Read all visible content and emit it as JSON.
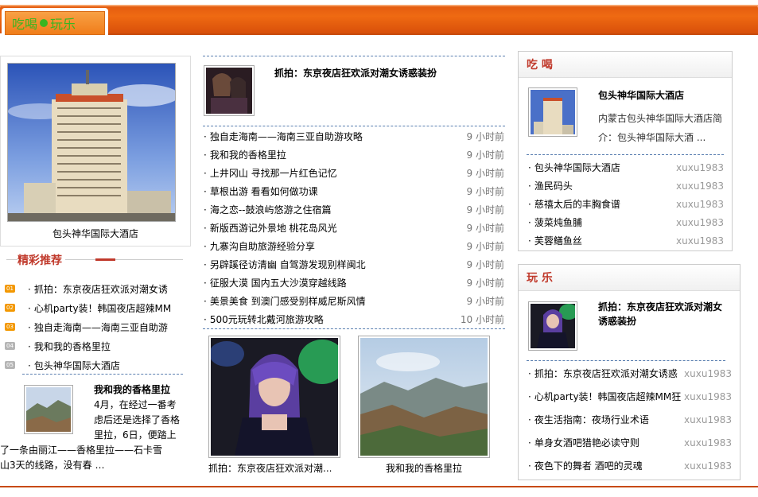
{
  "header": {
    "tab_part1": "吃喝",
    "tab_part2": "玩乐"
  },
  "left": {
    "feature_caption": "包头神华国际大酒店",
    "recommend_title": "精彩推荐",
    "recommend_items": [
      {
        "num": "01",
        "num_color": "#f39800",
        "label": "抓拍：东京夜店狂欢派对潮女诱"
      },
      {
        "num": "02",
        "num_color": "#f39800",
        "label": "心机party装！韩国夜店超辣MM"
      },
      {
        "num": "03",
        "num_color": "#f39800",
        "label": "独自走海南——海南三亚自助游"
      },
      {
        "num": "04",
        "num_color": "#b5b5b5",
        "label": "我和我的香格里拉"
      },
      {
        "num": "05",
        "num_color": "#b5b5b5",
        "label": "包头神华国际大酒店"
      }
    ],
    "article_title": "我和我的香格里拉",
    "article_line1": "4月，在经过一番考",
    "article_line2": "虑后还是选择了香格",
    "article_line3": "里拉，6日，便踏上",
    "article_line4": "了一条由丽江——香格里拉——石卡雪",
    "article_line5": "山3天的线路，没有春 …"
  },
  "middle": {
    "head_title": "抓拍：东京夜店狂欢派对潮女诱惑装扮",
    "list": [
      {
        "title": "独自走海南——海南三亚自助游攻略",
        "time": "9 小时前"
      },
      {
        "title": "我和我的香格里拉",
        "time": "9 小时前"
      },
      {
        "title": "上井冈山 寻找那一片红色记忆",
        "time": "9 小时前"
      },
      {
        "title": "草根出游 看看如何做功课",
        "time": "9 小时前"
      },
      {
        "title": "海之恋--鼓浪屿悠游之住宿篇",
        "time": "9 小时前"
      },
      {
        "title": "新版西游记外景地 桃花岛风光",
        "time": "9 小时前"
      },
      {
        "title": "九寨沟自助旅游经验分享",
        "time": "9 小时前"
      },
      {
        "title": "另辟蹊径访清幽 自驾游发现别样闽北",
        "time": "9 小时前"
      },
      {
        "title": "征服大漠 国内五大沙漠穿越线路",
        "time": "9 小时前"
      },
      {
        "title": "美景美食 到澳门感受别样威尼斯风情",
        "time": "9 小时前"
      },
      {
        "title": "500元玩转北戴河旅游攻略",
        "time": "10 小时前"
      }
    ],
    "pic1_caption": "抓拍：东京夜店狂欢派对潮...",
    "pic2_caption": "我和我的香格里拉"
  },
  "right": {
    "eat": {
      "heading": "吃 喝",
      "feature_title": "包头神华国际大酒店",
      "feature_desc": "内蒙古包头神华国际大酒店简介：包头神华国际大酒 ...",
      "items": [
        {
          "title": "包头神华国际大酒店",
          "author": "xuxu1983"
        },
        {
          "title": "渔民码头",
          "author": "xuxu1983"
        },
        {
          "title": "慈禧太后的丰胸食谱",
          "author": "xuxu1983"
        },
        {
          "title": "菠菜炖鱼脯",
          "author": "xuxu1983"
        },
        {
          "title": "芙蓉鳝鱼丝",
          "author": "xuxu1983"
        }
      ]
    },
    "play": {
      "heading": "玩 乐",
      "feature_title": "抓拍：东京夜店狂欢派对潮女诱惑装扮",
      "items": [
        {
          "title": "抓拍：东京夜店狂欢派对潮女诱惑",
          "author": "xuxu1983"
        },
        {
          "title": "心机party装！韩国夜店超辣MM狂",
          "author": "xuxu1983"
        },
        {
          "title": "夜生活指南：夜场行业术语",
          "author": "xuxu1983"
        },
        {
          "title": "单身女酒吧猎艳必读守则",
          "author": "xuxu1983"
        },
        {
          "title": "夜色下的舞者 酒吧的灵魂",
          "author": "xuxu1983"
        }
      ]
    }
  },
  "colors": {
    "accent_orange": "#e25a10",
    "heading_red": "#c0392b",
    "green_text": "#3bb521"
  }
}
